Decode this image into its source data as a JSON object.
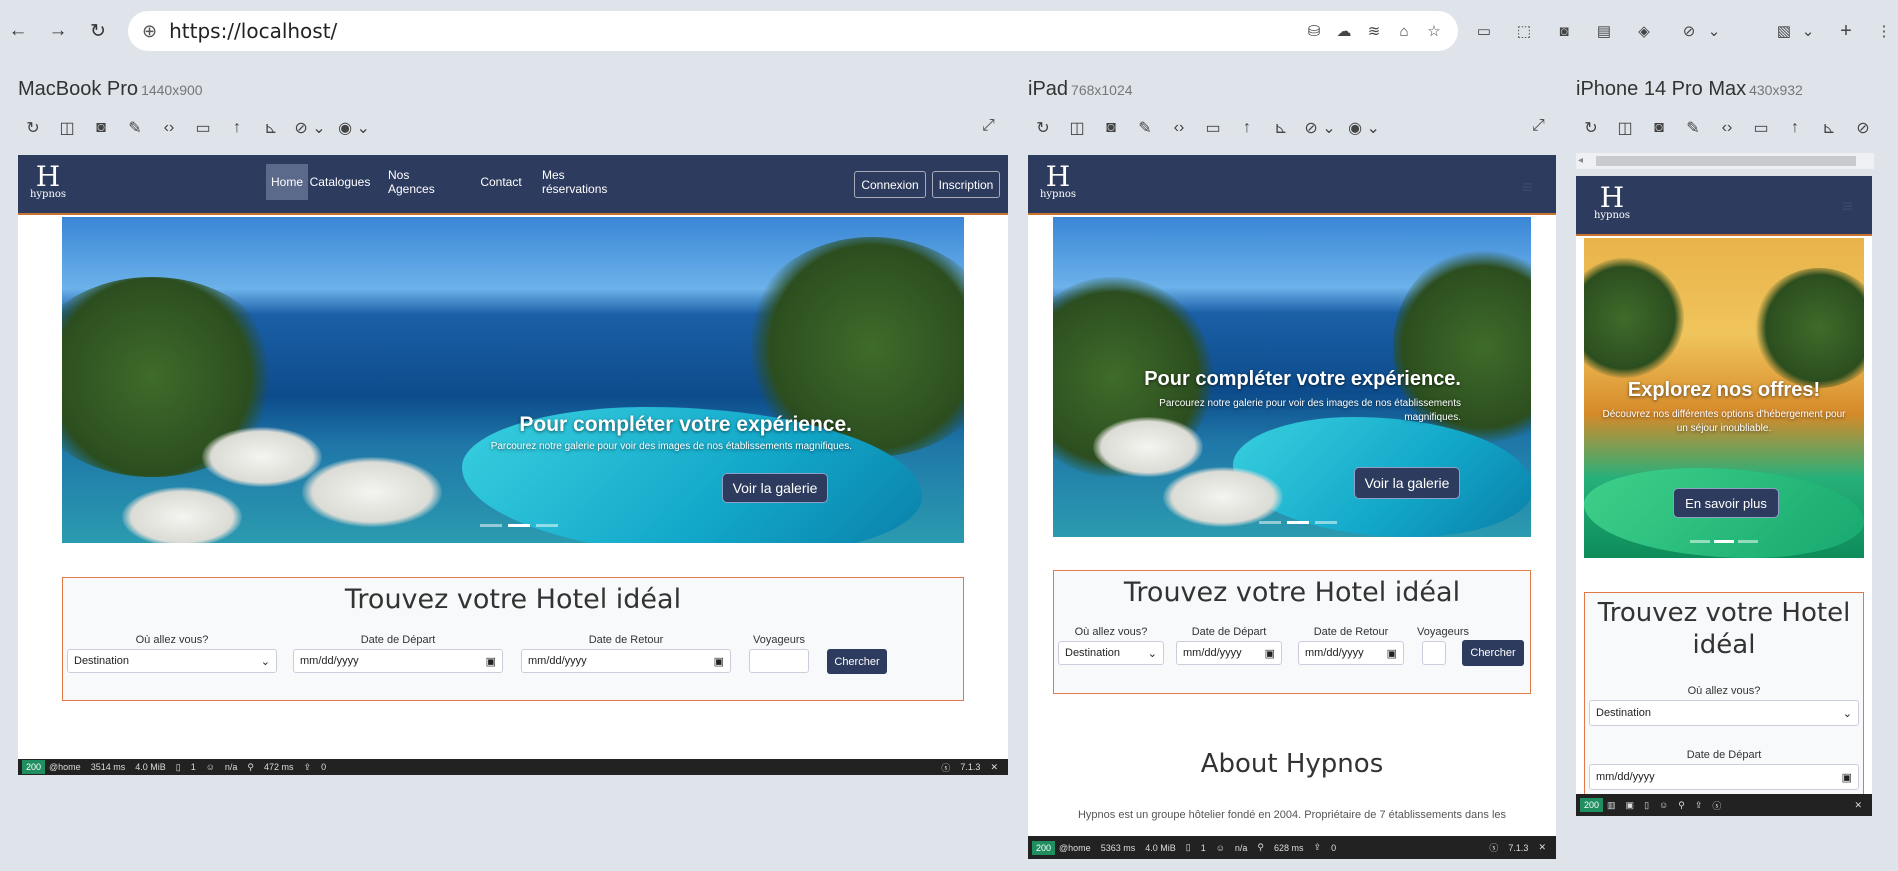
{
  "browser": {
    "url": "https://localhost/",
    "back_icon": "back-arrow-icon",
    "forward_icon": "forward-arrow-icon",
    "reload_icon": "reload-icon"
  },
  "devices": [
    {
      "name": "MacBook Pro",
      "dims": "1440x900"
    },
    {
      "name": "iPad",
      "dims": "768x1024"
    },
    {
      "name": "iPhone 14 Pro Max",
      "dims": "430x932"
    }
  ],
  "site": {
    "logo_text": "hypnos",
    "nav": [
      "Home",
      "Catalogues",
      "Nos Agences",
      "Contact",
      "Mes réservations"
    ],
    "login": "Connexion",
    "signup": "Inscription",
    "slide_gallery": {
      "title": "Pour compléter votre expérience.",
      "text": "Parcourez notre galerie pour voir des images de nos établissements magnifiques.",
      "button": "Voir la galerie"
    },
    "slide_offers": {
      "title": "Explorez nos offres!",
      "text": "Découvrez nos différentes options d'hébergement pour un séjour inoubliable.",
      "button": "En savoir plus"
    },
    "search": {
      "title": "Trouvez votre Hotel idéal",
      "where_label": "Où allez vous?",
      "where_value": "Destination",
      "depart_label": "Date de Départ",
      "return_label": "Date de Retour",
      "date_placeholder": "mm/dd/yyyy",
      "travelers_label": "Voyageurs",
      "button": "Chercher"
    },
    "about_title": "About Hypnos",
    "about_text": "Hypnos est un groupe hôtelier fondé en 2004. Propriétaire de 7 établissements dans les"
  },
  "debugbar": [
    {
      "status": "200",
      "route": "@home",
      "time": "3514 ms",
      "mem": "4.0 MiB",
      "files": "1",
      "user": "n/a",
      "ms": "472 ms",
      "count": "0",
      "ver": "7.1.3"
    },
    {
      "status": "200",
      "route": "@home",
      "time": "5363 ms",
      "mem": "4.0 MiB",
      "files": "1",
      "user": "n/a",
      "ms": "628 ms",
      "count": "0",
      "ver": "7.1.3"
    },
    {
      "status": "200"
    }
  ]
}
